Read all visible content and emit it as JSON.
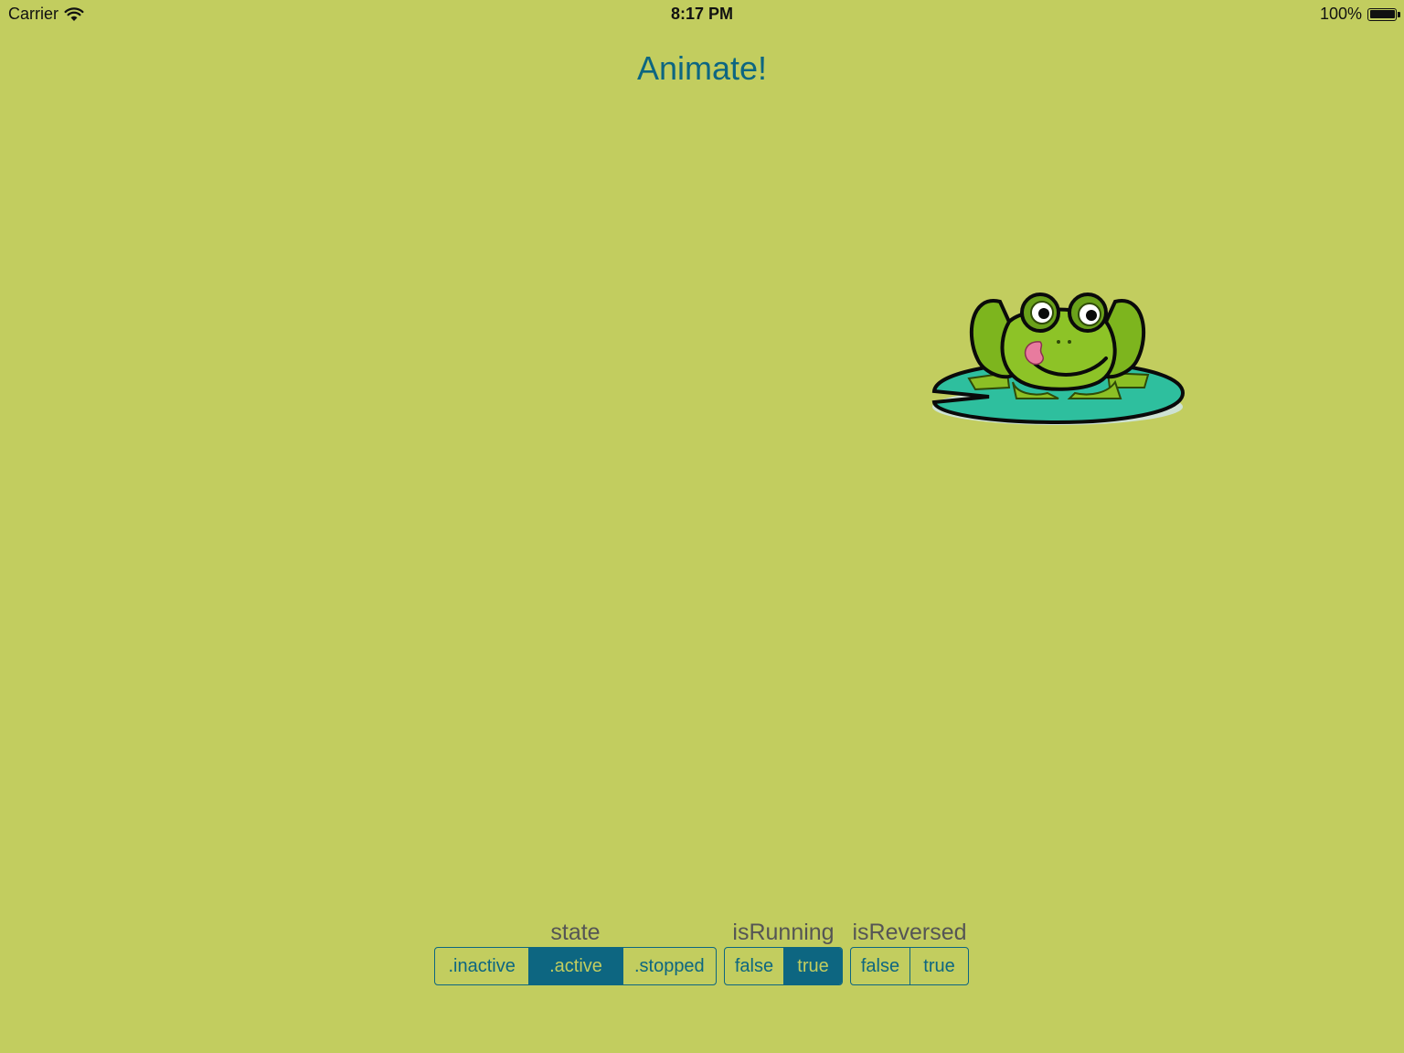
{
  "status_bar": {
    "carrier": "Carrier",
    "time": "8:17 PM",
    "battery": "100%",
    "battery_level": 1.0
  },
  "title_button": {
    "label": "Animate!"
  },
  "image": {
    "icon": "frog-on-lily-pad"
  },
  "controls": {
    "state": {
      "label": "state",
      "options": [
        ".inactive",
        ".active",
        ".stopped"
      ],
      "selected": ".active"
    },
    "is_running": {
      "label": "isRunning",
      "options": [
        "false",
        "true"
      ],
      "selected": "true"
    },
    "is_reversed": {
      "label": "isReversed",
      "options": [
        "false",
        "true"
      ],
      "selected": null
    }
  },
  "colors": {
    "background": "#c2cd5f",
    "accent": "#0d6681"
  }
}
